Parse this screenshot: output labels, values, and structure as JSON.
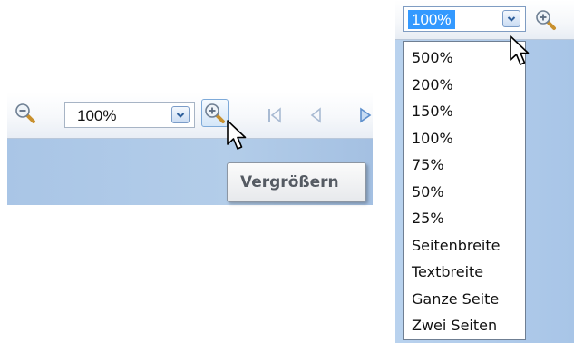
{
  "left_panel": {
    "zoom_out_icon": "zoom-out-magnifier",
    "zoom_combo": {
      "value": "100%"
    },
    "zoom_in_icon": "zoom-in-magnifier",
    "nav_icons": [
      "first-page",
      "previous-page",
      "next-page"
    ],
    "tooltip": {
      "text": "Vergrößern"
    }
  },
  "right_panel": {
    "zoom_combo": {
      "value": "100%"
    },
    "zoom_in_icon": "zoom-in-magnifier",
    "dropdown": {
      "options": [
        "500%",
        "200%",
        "150%",
        "100%",
        "75%",
        "50%",
        "25%",
        "Seitenbreite",
        "Textbreite",
        "Ganze Seite",
        "Zwei Seiten"
      ]
    }
  },
  "colors": {
    "selection": "#3399ff",
    "viewer_background": "#a9c5e6",
    "toolbar_border": "#b9c7d9"
  }
}
